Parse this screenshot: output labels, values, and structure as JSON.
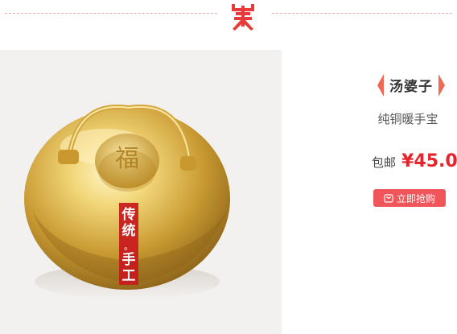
{
  "divider": {
    "logo_icon": "shop-logo-icon",
    "accent": "#e8393b"
  },
  "product": {
    "image_icon": "copper-hand-warmer-photo",
    "badge_chars": [
      "传",
      "统",
      "。",
      "手",
      "工"
    ],
    "lid_char": "福",
    "brand": "汤婆子",
    "name": "纯铜暖手宝",
    "shipping_label": "包邮",
    "price": "¥45.0",
    "buy_label": "立即抢购",
    "buy_icon": "cart-icon"
  },
  "colors": {
    "price": "#e8232b",
    "button_bg": "#f0555a",
    "brand_arrow": "#ef6a55"
  }
}
